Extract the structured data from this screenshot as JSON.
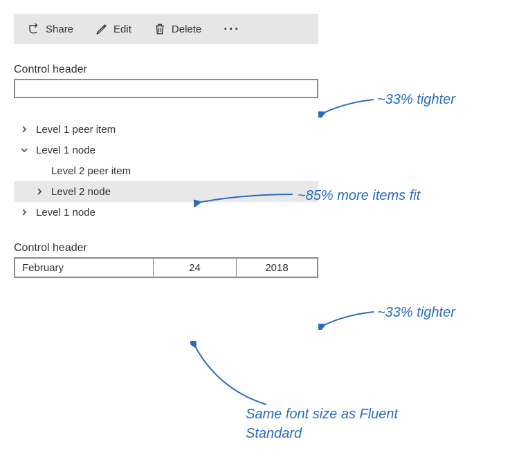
{
  "toolbar": {
    "share_label": "Share",
    "edit_label": "Edit",
    "delete_label": "Delete"
  },
  "textbox_section": {
    "header": "Control header"
  },
  "tree": {
    "items": [
      {
        "label": "Level 1 peer item"
      },
      {
        "label": "Level 1 node"
      },
      {
        "label": "Level 2 peer item"
      },
      {
        "label": "Level 2 node"
      },
      {
        "label": "Level 1 node"
      }
    ]
  },
  "date_section": {
    "header": "Control header",
    "month": "February",
    "day": "24",
    "year": "2018"
  },
  "annotations": {
    "top": "~33% tighter",
    "mid": "~85% more items fit",
    "low": "~33% tighter",
    "bottom": "Same font size as Fluent Standard"
  }
}
